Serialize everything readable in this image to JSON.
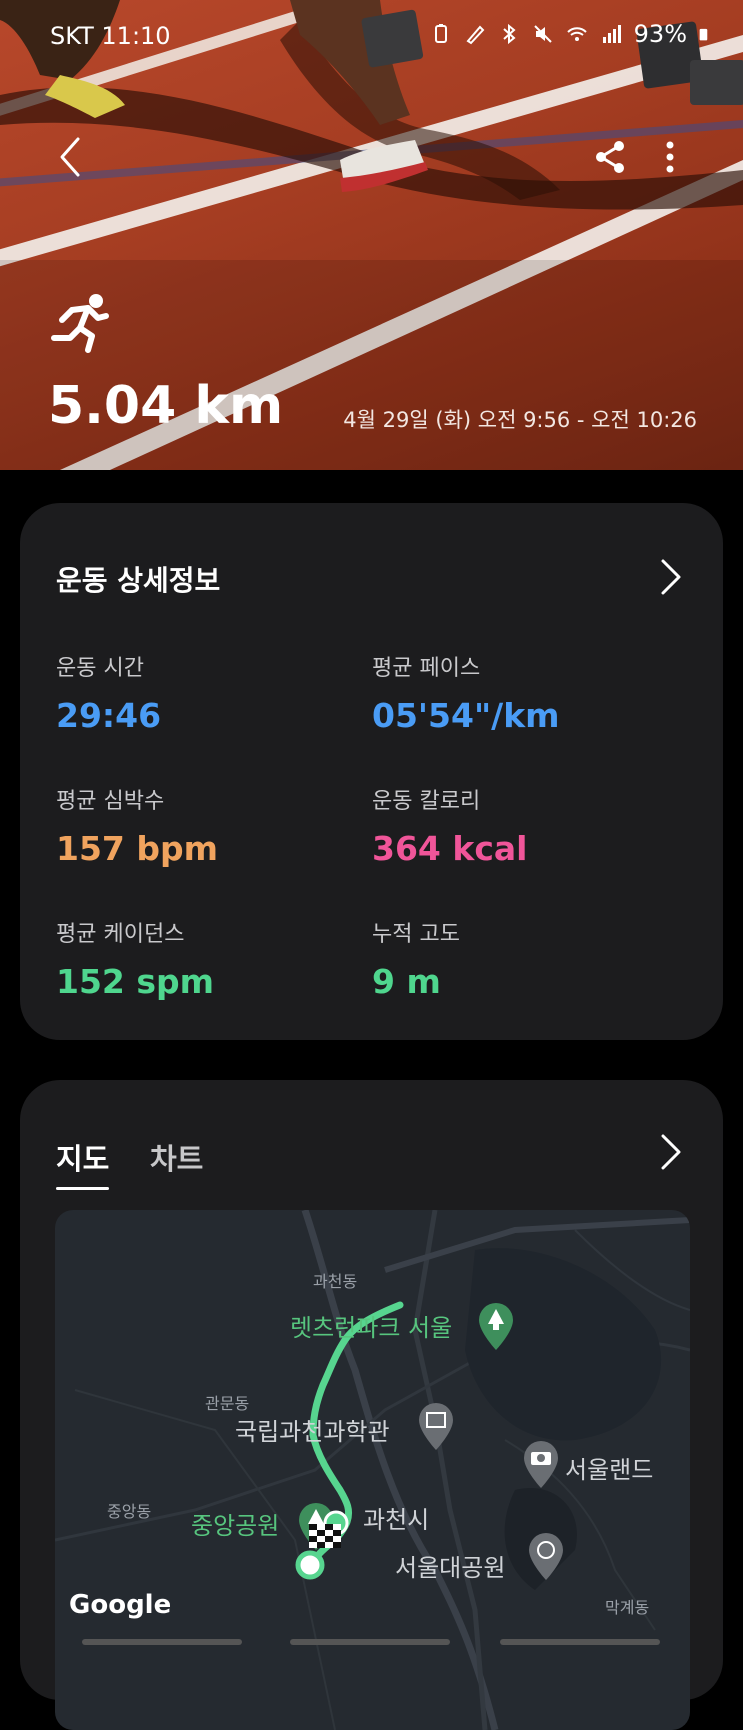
{
  "status": {
    "carrier_time": "SKT 11:10",
    "battery": "93%"
  },
  "hero": {
    "distance": "5.04 km",
    "datetime": "4월 29일 (화) 오전 9:56 - 오전 10:26"
  },
  "detail": {
    "title": "운동 상세정보",
    "stats": [
      {
        "label": "운동 시간",
        "value": "29:46",
        "color": "#4a9cf5"
      },
      {
        "label": "평균 페이스",
        "value": "05'54\"/km",
        "color": "#4a9cf5"
      },
      {
        "label": "평균 심박수",
        "value": "157 bpm",
        "color": "#f0a35e"
      },
      {
        "label": "운동 칼로리",
        "value": "364 kcal",
        "color": "#f05599"
      },
      {
        "label": "평균 케이던스",
        "value": "152 spm",
        "color": "#4fd68e"
      },
      {
        "label": "누적 고도",
        "value": "9 m",
        "color": "#4fd68e"
      }
    ]
  },
  "map_card": {
    "tabs": [
      {
        "label": "지도",
        "active": true
      },
      {
        "label": "차트",
        "active": false
      }
    ],
    "places": {
      "gwacheon_dong": "과천동",
      "letsrun_park": "렛츠런파크 서울",
      "gwanmun_dong": "관문동",
      "science_museum": "국립과천과학관",
      "seoul_land": "서울랜드",
      "jungang_dong": "중앙동",
      "central_park": "중앙공원",
      "gwacheon_si": "과천시",
      "seoul_grand_park": "서울대공원",
      "makgye_dong": "막계동"
    },
    "logo": "Google"
  }
}
